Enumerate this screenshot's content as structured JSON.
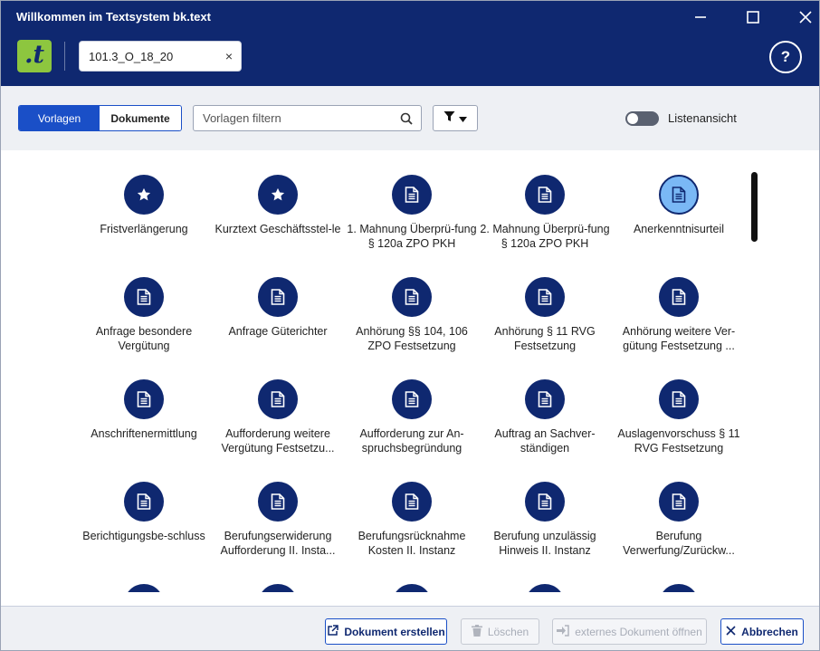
{
  "window": {
    "title": "Willkommen im Textsystem bk.text"
  },
  "header": {
    "logo_text": ".t",
    "file_tab": "101.3_O_18_20",
    "close_glyph": "×",
    "help_glyph": "?"
  },
  "toolbar": {
    "tabs": [
      {
        "label": "Vorlagen",
        "active": true
      },
      {
        "label": "Dokumente",
        "active": false
      }
    ],
    "search_placeholder": "Vorlagen filtern",
    "toggle_label": "Listenansicht",
    "toggle_on": false
  },
  "templates": [
    {
      "label": "Fristverlängerung",
      "icon": "star-icon"
    },
    {
      "label": "Kurztext Geschäftsstel-le",
      "icon": "star-icon"
    },
    {
      "label": "1. Mahnung Überprü-fung § 120a ZPO PKH",
      "icon": "document-icon"
    },
    {
      "label": "2. Mahnung Überprü-fung § 120a ZPO PKH",
      "icon": "document-icon"
    },
    {
      "label": "Anerkenntnisurteil",
      "icon": "document-icon",
      "selected": true
    },
    {
      "label": "Anfrage besondere Vergütung",
      "icon": "document-icon"
    },
    {
      "label": "Anfrage Güterichter",
      "icon": "document-icon"
    },
    {
      "label": "Anhörung §§ 104, 106 ZPO Festsetzung",
      "icon": "document-icon"
    },
    {
      "label": "Anhörung § 11 RVG Festsetzung",
      "icon": "document-icon"
    },
    {
      "label": "Anhörung weitere Ver-gütung Festsetzung ...",
      "icon": "document-icon"
    },
    {
      "label": "Anschriftenermittlung",
      "icon": "document-icon"
    },
    {
      "label": "Aufforderung weitere Vergütung Festsetzu...",
      "icon": "document-icon"
    },
    {
      "label": "Aufforderung zur An-spruchsbegründung",
      "icon": "document-icon"
    },
    {
      "label": "Auftrag an Sachver-ständigen",
      "icon": "document-icon"
    },
    {
      "label": "Auslagenvorschuss § 11 RVG Festsetzung",
      "icon": "document-icon"
    },
    {
      "label": "Berichtigungsbe-schluss",
      "icon": "document-icon"
    },
    {
      "label": "Berufungserwiderung Aufforderung II. Insta...",
      "icon": "document-icon"
    },
    {
      "label": "Berufungsrücknahme Kosten II. Instanz",
      "icon": "document-icon"
    },
    {
      "label": "Berufung unzulässig Hinweis II. Instanz",
      "icon": "document-icon"
    },
    {
      "label": "Berufung Verwerfung/Zurückw...",
      "icon": "document-icon"
    },
    {
      "label": "",
      "icon": "document-icon"
    },
    {
      "label": "",
      "icon": "document-icon"
    },
    {
      "label": "",
      "icon": "document-icon"
    },
    {
      "label": "",
      "icon": "document-icon"
    },
    {
      "label": "",
      "icon": "document-icon"
    }
  ],
  "footer": {
    "create_label": "Dokument erstellen",
    "delete_label": "Löschen",
    "open_external_label": "externes Dokument öffnen",
    "cancel_label": "Abbrechen"
  },
  "colors": {
    "header": "#0f2870",
    "accent": "#1a4fc7",
    "logo": "#8dc63f",
    "selected_icon": "#7ab8f5"
  }
}
